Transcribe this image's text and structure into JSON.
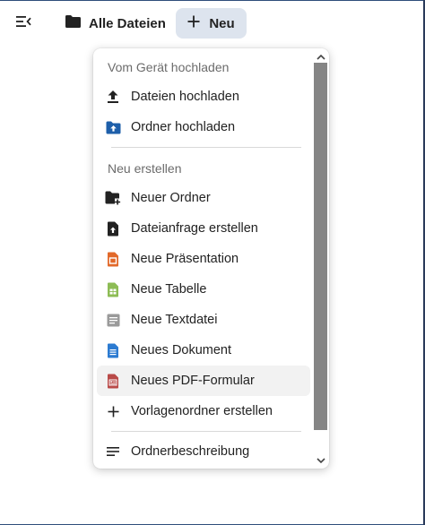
{
  "header": {
    "breadcrumb_root": "Alle Dateien",
    "new_button_label": "Neu",
    "icons": {
      "nav_toggle": "menu-collapse-icon",
      "folder": "folder-icon",
      "plus": "plus-icon"
    }
  },
  "menu": {
    "section_upload": {
      "title": "Vom Gerät hochladen",
      "items": [
        {
          "label": "Dateien hochladen",
          "icon": "upload-icon"
        },
        {
          "label": "Ordner hochladen",
          "icon": "folder-upload-icon"
        }
      ]
    },
    "section_create": {
      "title": "Neu erstellen",
      "items": [
        {
          "label": "Neuer Ordner",
          "icon": "folder-plus-icon"
        },
        {
          "label": "Dateianfrage erstellen",
          "icon": "file-upload-icon"
        },
        {
          "label": "Neue Präsentation",
          "icon": "presentation-icon"
        },
        {
          "label": "Neue Tabelle",
          "icon": "spreadsheet-icon"
        },
        {
          "label": "Neue Textdatei",
          "icon": "text-file-icon"
        },
        {
          "label": "Neues Dokument",
          "icon": "document-icon"
        },
        {
          "label": "Neues PDF-Formular",
          "icon": "pdf-form-icon"
        },
        {
          "label": "Vorlagenordner erstellen",
          "icon": "plus-icon"
        }
      ]
    },
    "footer_items": [
      {
        "label": "Ordnerbeschreibung",
        "icon": "description-icon"
      }
    ]
  },
  "colors": {
    "new_button_bg": "#dde4ee",
    "folder_blue": "#1e5faa",
    "presentation_orange": "#e2692a",
    "spreadsheet_green": "#8dbc55",
    "text_gray": "#9a9a9a",
    "document_blue": "#2c7bd1",
    "pdf_red": "#b94a48",
    "scroll_thumb": "#858585"
  }
}
